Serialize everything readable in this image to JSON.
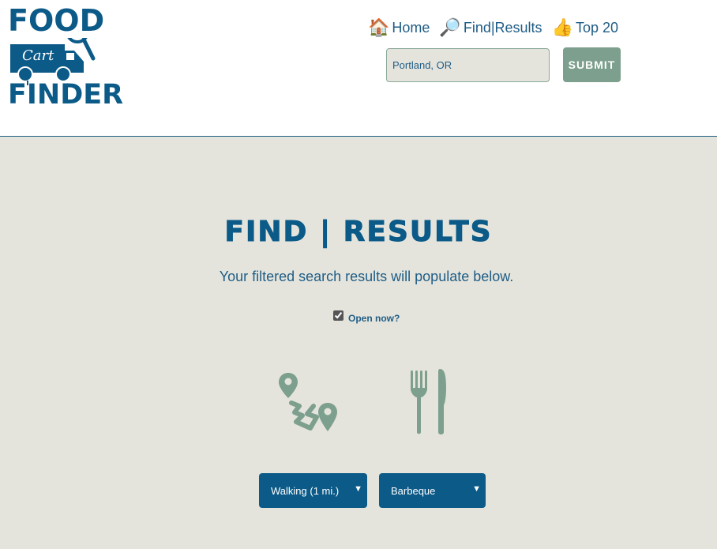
{
  "logo": {
    "word_top": "FOOD",
    "word_middle": "Cart",
    "word_bottom": "FINDER",
    "icon": "food-truck-magnifier-icon"
  },
  "nav": {
    "items": [
      {
        "label": "Home",
        "icon": "house-icon"
      },
      {
        "label": "Find|Results",
        "icon": "magnifier-icon"
      },
      {
        "label": "Top 20",
        "icon": "thumbs-up-icon"
      }
    ]
  },
  "search": {
    "value": "Portland, OR",
    "submit_label": "SUBMIT"
  },
  "main": {
    "title": "FIND | RESULTS",
    "subtitle": "Your filtered search results will populate below.",
    "open_now": {
      "label": "Open now?",
      "checked": true
    },
    "filters": {
      "distance": {
        "selected": "Walking (1 mi.)",
        "icon": "route-icon"
      },
      "cuisine": {
        "selected": "Barbeque",
        "icon": "fork-knife-icon"
      }
    }
  },
  "colors": {
    "brand_blue": "#0b5a88",
    "text_blue": "#1f5d86",
    "sage": "#7d9f8d",
    "background": "#e5e4dc"
  }
}
